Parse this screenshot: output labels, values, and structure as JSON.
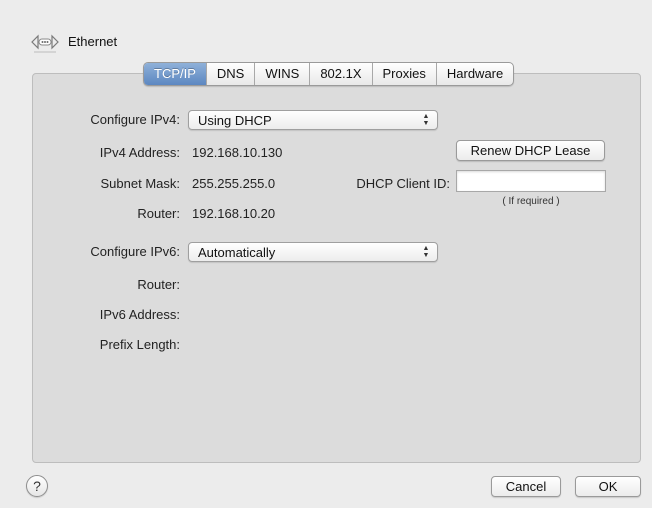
{
  "header": {
    "title": "Ethernet",
    "icon": "ethernet-icon"
  },
  "tabs": [
    {
      "label": "TCP/IP",
      "active": true
    },
    {
      "label": "DNS",
      "active": false
    },
    {
      "label": "WINS",
      "active": false
    },
    {
      "label": "802.1X",
      "active": false
    },
    {
      "label": "Proxies",
      "active": false
    },
    {
      "label": "Hardware",
      "active": false
    }
  ],
  "ipv4": {
    "configure_label": "Configure IPv4:",
    "configure_value": "Using DHCP",
    "address_label": "IPv4 Address:",
    "address_value": "192.168.10.130",
    "subnet_label": "Subnet Mask:",
    "subnet_value": "255.255.255.0",
    "router_label": "Router:",
    "router_value": "192.168.10.20",
    "renew_button": "Renew DHCP Lease",
    "dhcp_client_label": "DHCP Client ID:",
    "dhcp_client_value": "",
    "dhcp_client_hint": "( If required )"
  },
  "ipv6": {
    "configure_label": "Configure IPv6:",
    "configure_value": "Automatically",
    "router_label": "Router:",
    "address_label": "IPv6 Address:",
    "prefix_label": "Prefix Length:"
  },
  "footer": {
    "help": "?",
    "cancel": "Cancel",
    "ok": "OK"
  },
  "colors": {
    "active_tab": "#6b93c9",
    "panel": "#dcdcdc",
    "window": "#ececec"
  }
}
